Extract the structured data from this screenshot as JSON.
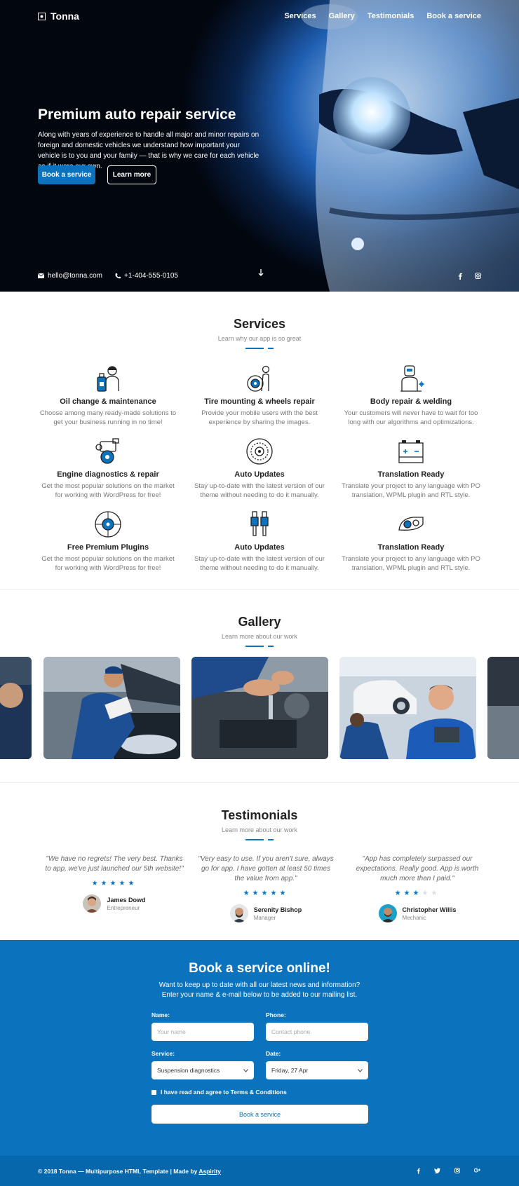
{
  "brand": {
    "name": "Tonna"
  },
  "nav": {
    "items": [
      "Services",
      "Gallery",
      "Testimonials",
      "Book a service"
    ]
  },
  "hero": {
    "title": "Premium auto repair service",
    "text": "Along with years of experience to handle all major and minor repairs on foreign and domestic vehicles we understand how important your vehicle is to you and your family — that is why we care for each vehicle as if it were our own.",
    "primary_button": "Book a service",
    "secondary_button": "Learn more",
    "email": "hello@tonna.com",
    "phone": "+1-404-555-0105"
  },
  "services": {
    "title": "Services",
    "subtitle": "Learn why our app is so great",
    "items": [
      {
        "title": "Oil change & maintenance",
        "text": "Choose among many ready-made solutions to get your business running in no time!",
        "icon": "mechanic-icon"
      },
      {
        "title": "Tire mounting & wheels repair",
        "text": "Provide your mobile users with the best experience by sharing the images.",
        "icon": "tire-icon"
      },
      {
        "title": "Body repair & welding",
        "text": "Your customers will never have to wait for too long with our algorithms and optimizations.",
        "icon": "welding-icon"
      },
      {
        "title": "Engine diagnostics & repair",
        "text": "Get the most popular solutions on the market for working with WordPress for free!",
        "icon": "engine-icon"
      },
      {
        "title": "Auto Updates",
        "text": "Stay up-to-date with the latest version of our theme without needing to do it manually.",
        "icon": "brake-disc-icon"
      },
      {
        "title": "Translation Ready",
        "text": "Translate your project to any language with PO translation, WPML plugin and RTL style.",
        "icon": "battery-icon"
      },
      {
        "title": "Free Premium Plugins",
        "text": "Get the most popular solutions on the market for working with WordPress for free!",
        "icon": "wheel-icon"
      },
      {
        "title": "Auto Updates",
        "text": "Stay up-to-date with the latest version of our theme without needing to do it manually.",
        "icon": "spark-plug-icon"
      },
      {
        "title": "Translation Ready",
        "text": "Translate your project to any language with PO translation, WPML plugin and RTL style.",
        "icon": "headlight-icon"
      }
    ]
  },
  "gallery": {
    "title": "Gallery",
    "subtitle": "Learn more about our work"
  },
  "testimonials": {
    "title": "Testimonials",
    "subtitle": "Learn more about our work",
    "items": [
      {
        "quote": "\"We have no regrets! The very best. Thanks to app, we've just launched our 5th website!\"",
        "rating": 5,
        "name": "James Dowd",
        "role": "Entrepreneur"
      },
      {
        "quote": "\"Very easy to use. If you aren't sure, always go for app. I have gotten at least 50 times the value from app.\"",
        "rating": 5,
        "name": "Serenity Bishop",
        "role": "Manager"
      },
      {
        "quote": "\"App has completely surpassed our expectations. Really good. App is worth much more than I paid.\"",
        "rating": 3,
        "name": "Christopher Willis",
        "role": "Mechanic"
      }
    ]
  },
  "booking": {
    "title": "Book a service online!",
    "subtitle": "Want to keep up to date with all our latest news and information? Enter your name & e-mail below to be added to our mailing list.",
    "name_label": "Name:",
    "name_placeholder": "Your name",
    "phone_label": "Phone:",
    "phone_placeholder": "Contact phone",
    "service_label": "Service:",
    "service_value": "Suspension diagnostics",
    "date_label": "Date:",
    "date_value": "Friday, 27 Apr",
    "terms": "I have read and agree to Terms & Conditions",
    "submit": "Book a service"
  },
  "footer": {
    "text": "© 2018 Tonna — Multipurpose HTML Template | Made by ",
    "link": "Aspirity"
  },
  "colors": {
    "accent": "#0b72be"
  }
}
